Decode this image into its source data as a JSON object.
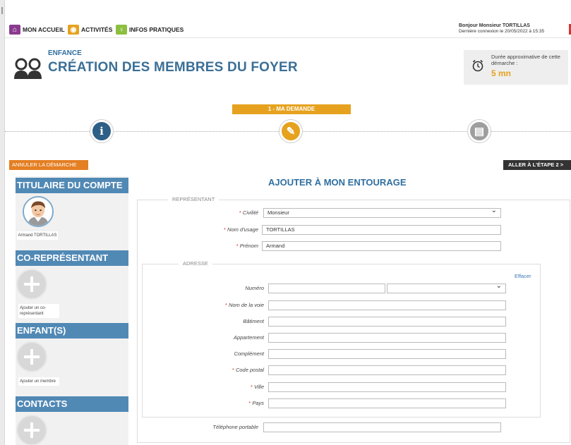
{
  "nav": {
    "items": [
      {
        "label": "MON ACCUEIL",
        "icon": "home-icon",
        "color": "#8b3b8f"
      },
      {
        "label": "ACTIVITÉS",
        "icon": "activities-icon",
        "color": "#e6a21f"
      },
      {
        "label": "INFOS PRATIQUES",
        "icon": "info-bulb-icon",
        "color": "#8cbf3f"
      }
    ],
    "greeting": "Bonjour Monsieur TORTILLAS",
    "last_login": "Dernière connexion le 20/05/2022 à 15:35"
  },
  "header": {
    "category": "ENFANCE",
    "title": "CRÉATION DES MEMBRES DU FOYER",
    "duration_label": "Durée approximative de cette démarche :",
    "duration_value": "5 mn"
  },
  "stepper": {
    "current_label": "1 - MA DEMANDE",
    "steps": [
      {
        "icon": "info-icon",
        "glyph": "i",
        "color": "#2e5f87"
      },
      {
        "icon": "pencil-icon",
        "glyph": "✎",
        "color": "#e6a21f"
      },
      {
        "icon": "document-icon",
        "glyph": "▤",
        "color": "#9e9e9e"
      }
    ]
  },
  "actions": {
    "cancel": "ANNULER LA DÉMARCHE",
    "next": "ALLER À L'ÉTAPE 2 >"
  },
  "left": {
    "titulaire_heading": "TITULAIRE DU COMPTE",
    "titulaire_name": "Armand TORTILLAS",
    "corep_heading": "CO-REPRÉSENTANT",
    "corep_add": "Ajouter un co-représentant",
    "enfants_heading": "ENFANT(S)",
    "enfants_add": "Ajouter un membre",
    "contacts_heading": "CONTACTS"
  },
  "form": {
    "title": "AJOUTER À MON ENTOURAGE",
    "representant_legend": "REPRÉSENTANT",
    "civilite_label": "Civilité",
    "civilite_value": "Monsieur",
    "nom_usage_label": "Nom d'usage",
    "nom_usage_value": "TORTILLAS",
    "prenom_label": "Prénom",
    "prenom_value": "Armand",
    "adresse_legend": "ADRESSE",
    "effacer": "Effacer",
    "numero_label": "Numéro",
    "voie_label": "Nom de la voie",
    "batiment_label": "Bâtiment",
    "appartement_label": "Appartement",
    "complement_label": "Complément",
    "cp_label": "Code postal",
    "ville_label": "Ville",
    "pays_label": "Pays",
    "tel_label": "Téléphone portable",
    "required_mark": "*"
  }
}
